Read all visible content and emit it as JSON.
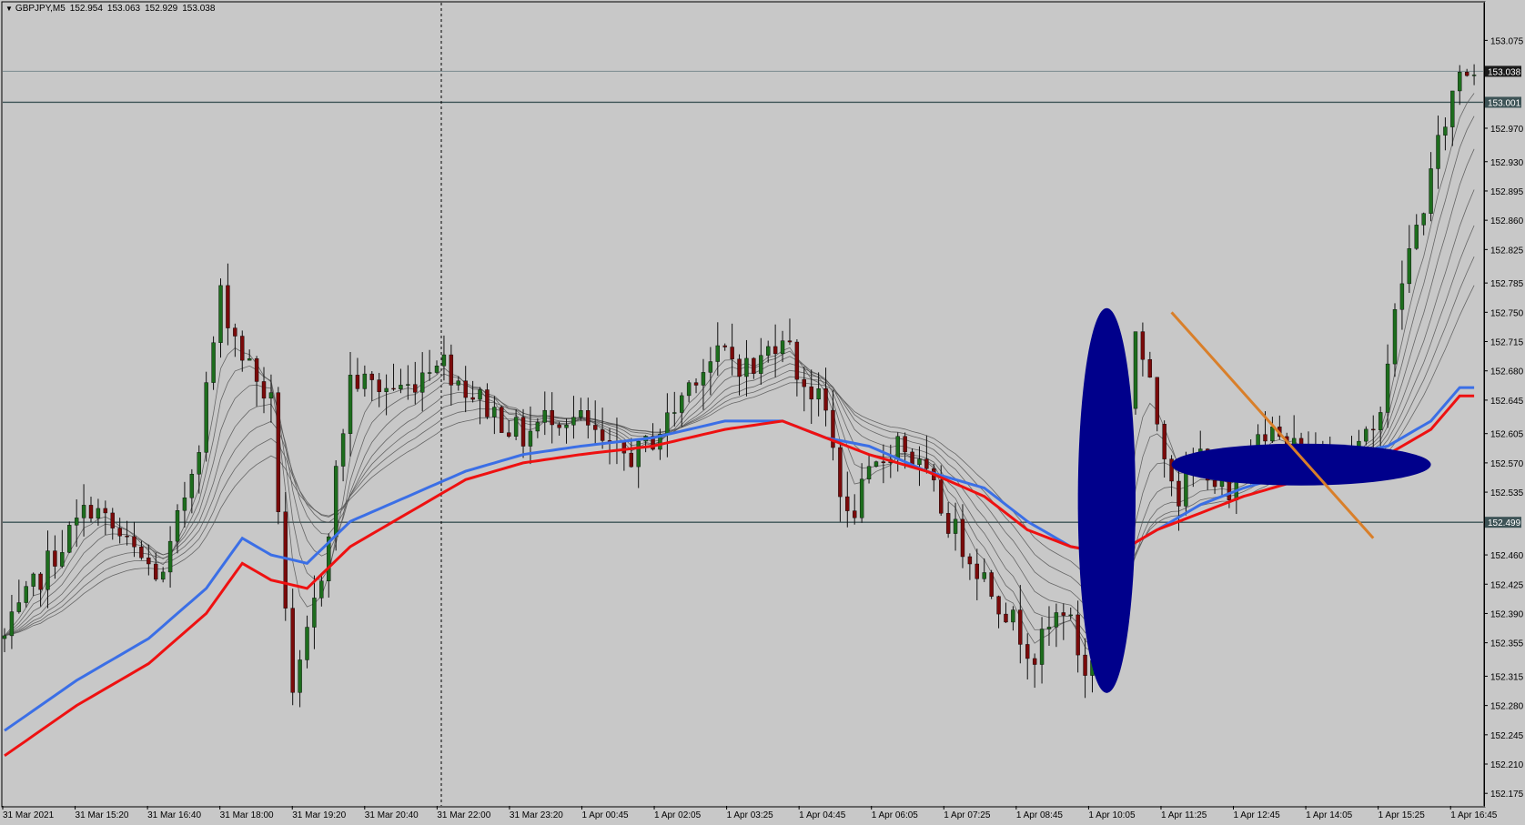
{
  "header": {
    "symbol": "GBPJPY,M5",
    "open": "152.954",
    "high": "153.063",
    "low": "152.929",
    "close": "153.038"
  },
  "colors": {
    "background": "#c8c8c8",
    "grid": "#000000",
    "bull_candle": "#1d6d1d",
    "bear_candle": "#7a0a0a",
    "wick": "#111111",
    "ema_blue": "#3b6fe6",
    "ema_red": "#ee1111",
    "ribbon": "#555555",
    "ellipse": "#00008b",
    "trendline": "#d97f2a",
    "hline": "#3d5356",
    "price_line": "#7a8a8f"
  },
  "chart_data": {
    "type": "candlestick",
    "title": "GBPJPY,M5",
    "ylim": [
      152.16,
      153.12
    ],
    "y_ticks": [
      "153.075",
      "153.038",
      "153.001",
      "152.970",
      "152.930",
      "152.895",
      "152.860",
      "152.825",
      "152.785",
      "152.750",
      "152.715",
      "152.680",
      "152.645",
      "152.605",
      "152.570",
      "152.535",
      "152.499",
      "152.460",
      "152.425",
      "152.390",
      "152.355",
      "152.315",
      "152.280",
      "152.245",
      "152.210",
      "152.175"
    ],
    "x_ticks": [
      "31 Mar 2021",
      "31 Mar 15:20",
      "31 Mar 16:40",
      "31 Mar 18:00",
      "31 Mar 19:20",
      "31 Mar 20:40",
      "31 Mar 22:00",
      "31 Mar 23:20",
      "1 Apr 00:45",
      "1 Apr 02:05",
      "1 Apr 03:25",
      "1 Apr 04:45",
      "1 Apr 06:05",
      "1 Apr 07:25",
      "1 Apr 08:45",
      "1 Apr 10:05",
      "1 Apr 11:25",
      "1 Apr 12:45",
      "1 Apr 14:05",
      "1 Apr 15:25",
      "1 Apr 16:45"
    ],
    "horizontal_levels": [
      {
        "price": 153.001,
        "label": "153.001"
      },
      {
        "price": 152.499,
        "label": "152.499"
      }
    ],
    "current_price": {
      "price": 153.038,
      "label": "153.038"
    },
    "price_path": [
      [
        0,
        152.36
      ],
      [
        6,
        152.45
      ],
      [
        12,
        152.52
      ],
      [
        17,
        152.47
      ],
      [
        22,
        152.43
      ],
      [
        27,
        152.6
      ],
      [
        30,
        152.77
      ],
      [
        33,
        152.7
      ],
      [
        37,
        152.64
      ],
      [
        40,
        152.28
      ],
      [
        44,
        152.44
      ],
      [
        48,
        152.67
      ],
      [
        52,
        152.66
      ],
      [
        56,
        152.66
      ],
      [
        60,
        152.7
      ],
      [
        64,
        152.66
      ],
      [
        68,
        152.63
      ],
      [
        72,
        152.6
      ],
      [
        76,
        152.63
      ],
      [
        80,
        152.62
      ],
      [
        84,
        152.58
      ],
      [
        88,
        152.58
      ],
      [
        92,
        152.62
      ],
      [
        96,
        152.68
      ],
      [
        100,
        152.7
      ],
      [
        104,
        152.68
      ],
      [
        108,
        152.73
      ],
      [
        110,
        152.68
      ],
      [
        114,
        152.63
      ],
      [
        117,
        152.5
      ],
      [
        120,
        152.55
      ],
      [
        124,
        152.6
      ],
      [
        128,
        152.55
      ],
      [
        131,
        152.5
      ],
      [
        134,
        152.46
      ],
      [
        137,
        152.42
      ],
      [
        140,
        152.38
      ],
      [
        143,
        152.34
      ],
      [
        147,
        152.4
      ],
      [
        150,
        152.32
      ],
      [
        153,
        152.35
      ],
      [
        154,
        152.47
      ],
      [
        157,
        152.73
      ],
      [
        160,
        152.62
      ],
      [
        163,
        152.53
      ],
      [
        166,
        152.58
      ],
      [
        170,
        152.52
      ],
      [
        174,
        152.62
      ],
      [
        178,
        152.59
      ],
      [
        182,
        152.58
      ],
      [
        186,
        152.58
      ],
      [
        190,
        152.6
      ],
      [
        194,
        152.79
      ],
      [
        197,
        152.88
      ],
      [
        200,
        152.98
      ],
      [
        202,
        153.04
      ]
    ],
    "ema_blue_path": [
      [
        0,
        152.25
      ],
      [
        10,
        152.31
      ],
      [
        20,
        152.36
      ],
      [
        28,
        152.42
      ],
      [
        33,
        152.48
      ],
      [
        37,
        152.46
      ],
      [
        42,
        152.45
      ],
      [
        48,
        152.5
      ],
      [
        56,
        152.53
      ],
      [
        64,
        152.56
      ],
      [
        72,
        152.58
      ],
      [
        80,
        152.59
      ],
      [
        90,
        152.6
      ],
      [
        100,
        152.62
      ],
      [
        108,
        152.62
      ],
      [
        114,
        152.6
      ],
      [
        120,
        152.59
      ],
      [
        128,
        152.56
      ],
      [
        136,
        152.54
      ],
      [
        142,
        152.5
      ],
      [
        148,
        152.47
      ],
      [
        154,
        152.46
      ],
      [
        160,
        152.49
      ],
      [
        166,
        152.52
      ],
      [
        172,
        152.54
      ],
      [
        180,
        152.56
      ],
      [
        186,
        152.58
      ],
      [
        192,
        152.59
      ],
      [
        198,
        152.62
      ],
      [
        202,
        152.66
      ]
    ],
    "ema_red_path": [
      [
        0,
        152.22
      ],
      [
        10,
        152.28
      ],
      [
        20,
        152.33
      ],
      [
        28,
        152.39
      ],
      [
        33,
        152.45
      ],
      [
        37,
        152.43
      ],
      [
        42,
        152.42
      ],
      [
        48,
        152.47
      ],
      [
        56,
        152.51
      ],
      [
        64,
        152.55
      ],
      [
        72,
        152.57
      ],
      [
        80,
        152.58
      ],
      [
        90,
        152.59
      ],
      [
        100,
        152.61
      ],
      [
        108,
        152.62
      ],
      [
        114,
        152.6
      ],
      [
        120,
        152.58
      ],
      [
        128,
        152.56
      ],
      [
        136,
        152.53
      ],
      [
        142,
        152.49
      ],
      [
        148,
        152.47
      ],
      [
        154,
        152.46
      ],
      [
        160,
        152.49
      ],
      [
        166,
        152.51
      ],
      [
        172,
        152.53
      ],
      [
        180,
        152.55
      ],
      [
        186,
        152.57
      ],
      [
        192,
        152.58
      ],
      [
        198,
        152.61
      ],
      [
        202,
        152.65
      ]
    ],
    "annotations": [
      {
        "type": "ellipse",
        "center_bar": 153,
        "center_price": 152.525,
        "half_width_bars": 4,
        "half_height_price": 0.23
      },
      {
        "type": "ellipse",
        "center_bar": 180,
        "center_price": 152.568,
        "half_width_bars": 18,
        "half_height_price": 0.025
      },
      {
        "type": "trendline",
        "from_bar": 162,
        "from_price": 152.75,
        "to_bar": 190,
        "to_price": 152.48
      }
    ]
  }
}
